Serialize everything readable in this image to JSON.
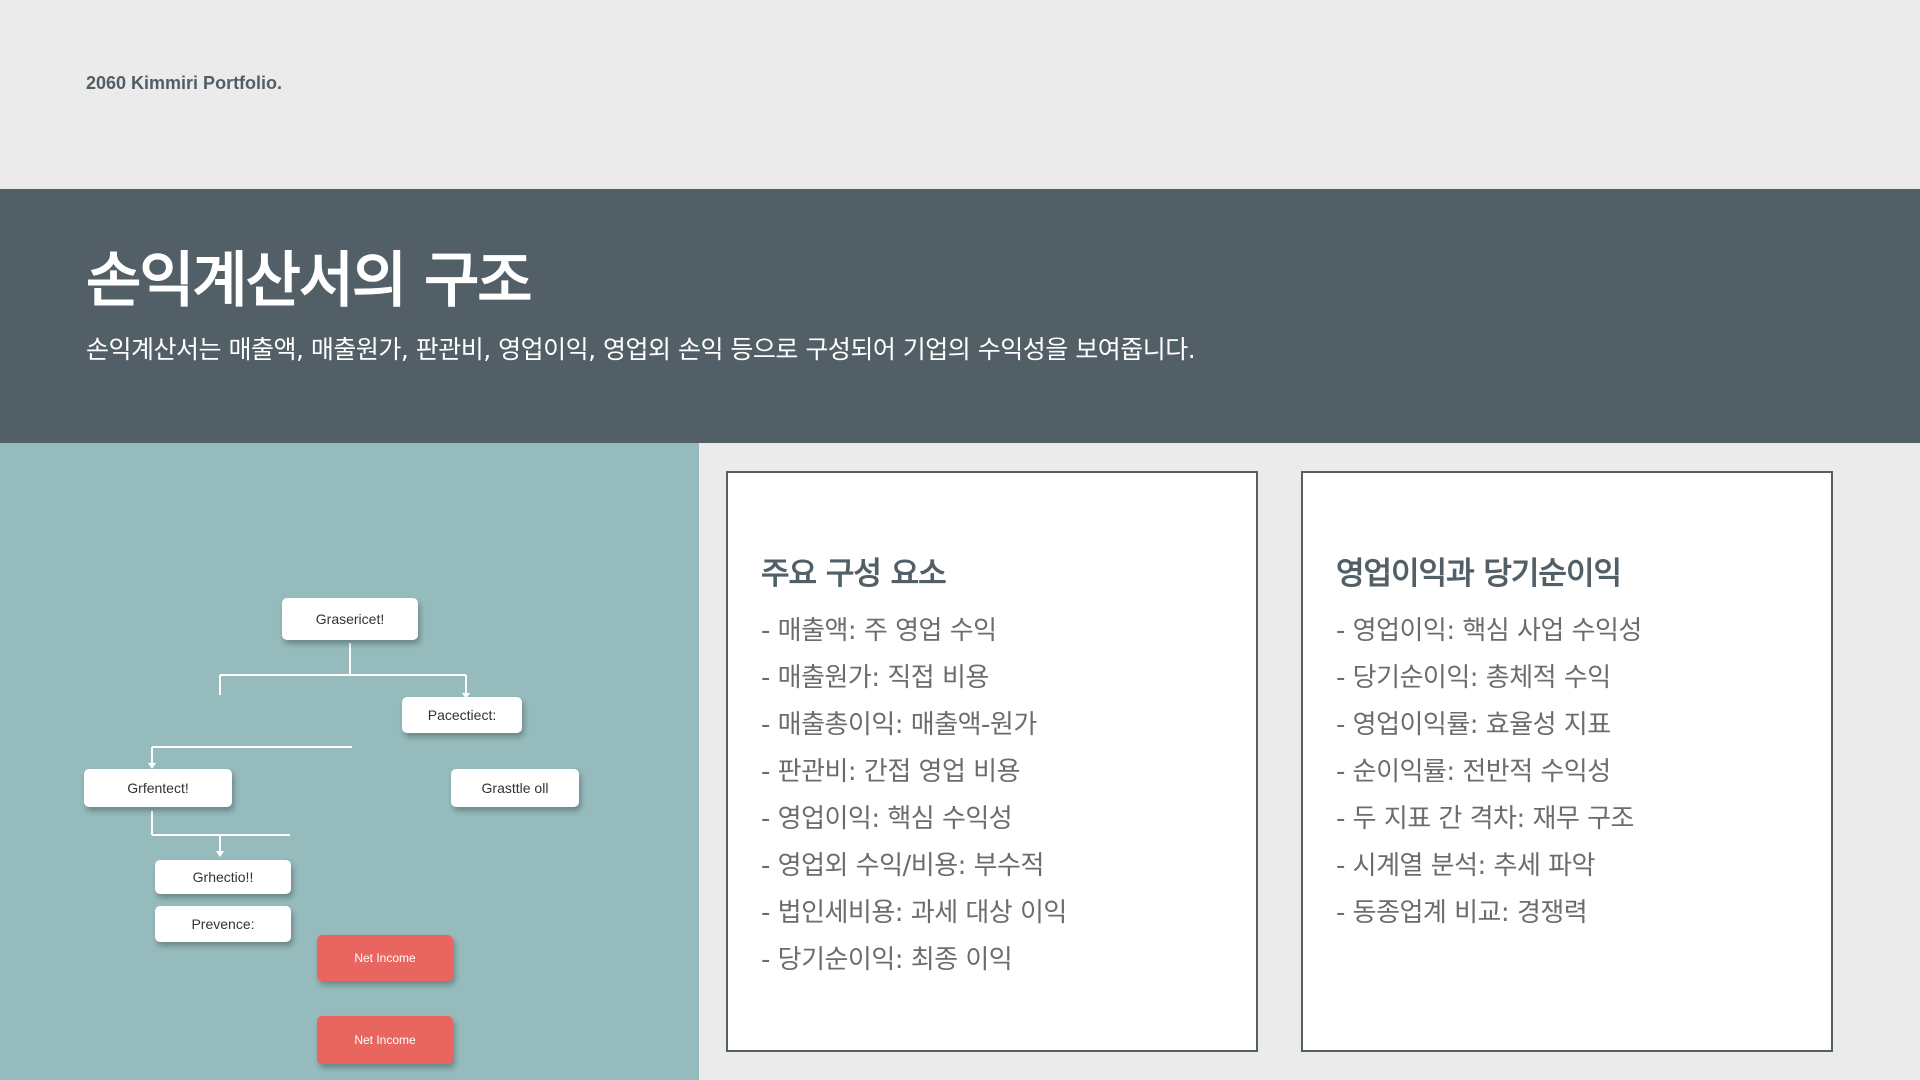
{
  "header": {
    "label": "2060 Kimmiri Portfolio."
  },
  "banner": {
    "title": "손익계산서의 구조",
    "subtitle": "손익계산서는 매출액, 매출원가, 판관비, 영업이익, 영업외 손익 등으로 구성되어 기업의 수익성을 보여줍니다."
  },
  "image": {
    "nodes": [
      "Grasericet!",
      "Pacectiect:",
      "Grfentect!",
      "Grasttle oll",
      "Grhectio!!",
      "Prevence:",
      "Net Income",
      "Net Income"
    ]
  },
  "cards": [
    {
      "title": "주요 구성 요소",
      "items": [
        "- 매출액: 주 영업 수익",
        "- 매출원가: 직접 비용",
        "- 매출총이익: 매출액-원가",
        "- 판관비: 간접 영업 비용",
        "- 영업이익: 핵심 수익성",
        "- 영업외 수익/비용: 부수적",
        "- 법인세비용: 과세 대상 이익",
        "- 당기순이익: 최종 이익"
      ]
    },
    {
      "title": "영업이익과 당기순이익",
      "items": [
        "- 영업이익: 핵심 사업 수익성",
        "- 당기순이익: 총체적 수익",
        "- 영업이익률: 효율성 지표",
        "- 순이익률: 전반적 수익성",
        "- 두 지표 간 격차: 재무 구조",
        "- 시계열 분석: 추세 파악",
        "- 동종업계 비교: 경쟁력"
      ]
    }
  ],
  "colors": {
    "banner": "#525f66",
    "background": "#ebebeb",
    "image_bg": "#95bbbd",
    "accent_red": "#e9655f"
  }
}
